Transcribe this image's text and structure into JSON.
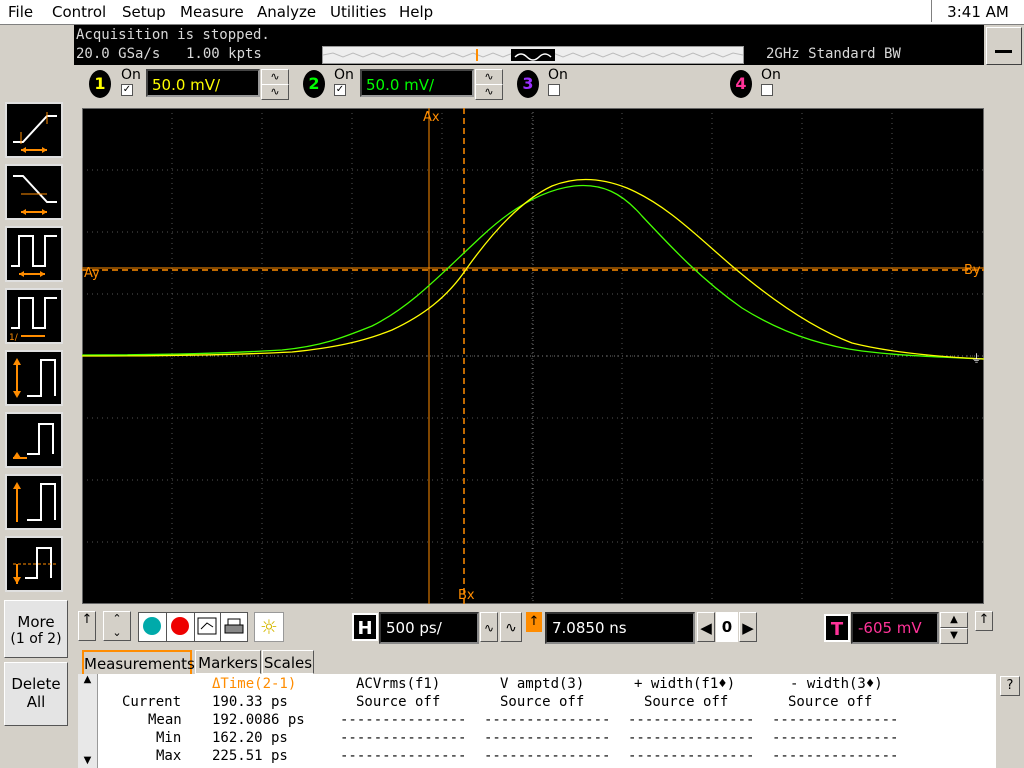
{
  "menu": [
    "File",
    "Control",
    "Setup",
    "Measure",
    "Analyze",
    "Utilities",
    "Help"
  ],
  "clock": "3:41 AM",
  "acquisition": {
    "status": "Acquisition is stopped.",
    "rate": "20.0 GSa/s",
    "points": "1.00 kpts",
    "bandwidth": "2GHz Standard BW"
  },
  "channels": [
    {
      "num": "1",
      "on_label": "On",
      "checked": "✓",
      "scale": "50.0 mV/",
      "color": "#ffff00"
    },
    {
      "num": "2",
      "on_label": "On",
      "checked": "✓",
      "scale": "50.0 mV/",
      "color": "#00ff00"
    },
    {
      "num": "3",
      "on_label": "On",
      "checked": "",
      "color": "#9b30ff"
    },
    {
      "num": "4",
      "on_label": "On",
      "checked": "",
      "color": "#ff3399"
    }
  ],
  "markers": {
    "ax": "Ax",
    "bx": "Bx",
    "ay": "Ay",
    "by": "By"
  },
  "sidebar": {
    "more": "More",
    "more_page": "(1 of 2)",
    "delete": "Delete",
    "delete_all": "All"
  },
  "horizontal": {
    "label": "H",
    "scale": "500 ps/",
    "delay": "7.0850 ns",
    "ref": "0"
  },
  "trigger": {
    "label": "T",
    "level": "-605 mV"
  },
  "tabs": [
    "Measurements",
    "Markers",
    "Scales"
  ],
  "measurements": {
    "row_labels": [
      "Current",
      "Mean",
      "Min",
      "Max"
    ],
    "columns": [
      {
        "header": "ΔTime(2-1)",
        "values": [
          "190.33 ps",
          "192.0086 ps",
          "162.20 ps",
          "225.51 ps"
        ]
      },
      {
        "header": "ACVrms(f1)",
        "values": [
          "Source off",
          "---------------",
          "---------------",
          "---------------"
        ]
      },
      {
        "header": "V amptd(3)",
        "values": [
          "Source off",
          "---------------",
          "---------------",
          "---------------"
        ]
      },
      {
        "header": "+ width(f1♦)",
        "values": [
          "Source off",
          "---------------",
          "---------------",
          "---------------"
        ]
      },
      {
        "header": "- width(3♦)",
        "values": [
          "Source off",
          "---------------",
          "---------------",
          "---------------"
        ]
      }
    ]
  },
  "help": "?"
}
